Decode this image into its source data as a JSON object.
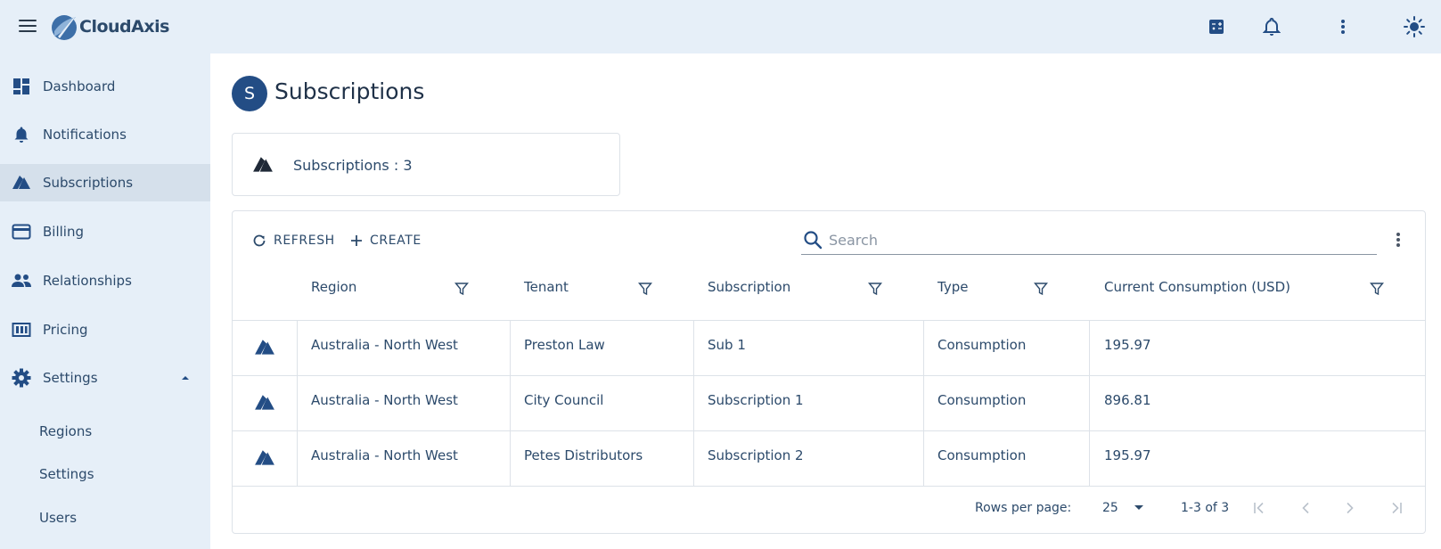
{
  "app": {
    "brand": "CloudAxis",
    "accent_color": "#234d85",
    "topbar_bg": "#e6eff8",
    "top_icons": [
      "calculator-icon",
      "bell-icon",
      "more-vert-icon",
      "sun-icon"
    ]
  },
  "sidebar": {
    "items": [
      {
        "label": "Dashboard",
        "icon": "dashboard-icon"
      },
      {
        "label": "Notifications",
        "icon": "bell-icon"
      },
      {
        "label": "Subscriptions",
        "icon": "azure-icon",
        "active": true
      },
      {
        "label": "Billing",
        "icon": "credit-card-icon"
      },
      {
        "label": "Relationships",
        "icon": "people-icon"
      },
      {
        "label": "Pricing",
        "icon": "pricing-icon"
      },
      {
        "label": "Settings",
        "icon": "gear-icon",
        "expanded": true
      }
    ],
    "sub_items": [
      {
        "label": "Regions"
      },
      {
        "label": "Settings"
      },
      {
        "label": "Users"
      }
    ]
  },
  "page": {
    "avatar_letter": "S",
    "title": "Subscriptions"
  },
  "stat_card": {
    "label": "Subscriptions : 3"
  },
  "toolbar": {
    "refresh_label": "REFRESH",
    "create_label": "CREATE",
    "search_placeholder": "Search"
  },
  "table": {
    "columns": [
      "Region",
      "Tenant",
      "Subscription",
      "Type",
      "Current Consumption (USD)"
    ],
    "rows": [
      {
        "region": "Australia - North West",
        "tenant": "Preston Law",
        "subscription": "Sub 1",
        "type": "Consumption",
        "consumption": "195.97"
      },
      {
        "region": "Australia - North West",
        "tenant": "City Council",
        "subscription": "Subscription 1",
        "type": "Consumption",
        "consumption": "896.81"
      },
      {
        "region": "Australia - North West",
        "tenant": "Petes Distributors",
        "subscription": "Subscription 2",
        "type": "Consumption",
        "consumption": "195.97"
      }
    ]
  },
  "pagination": {
    "rows_per_page_label": "Rows per page:",
    "rows_per_page": "25",
    "range": "1-3 of 3"
  }
}
